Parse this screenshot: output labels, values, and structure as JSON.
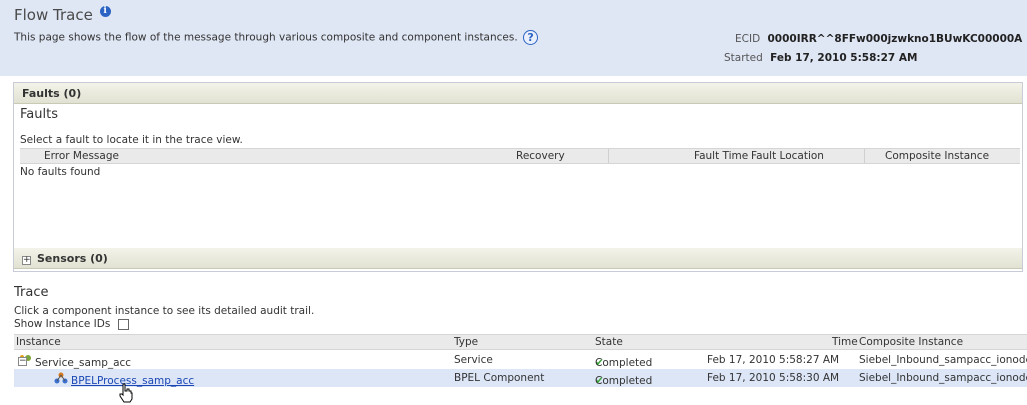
{
  "header": {
    "title": "Flow Trace",
    "description": "This page shows the flow of the message through various composite and component instances.",
    "ecid_label": "ECID",
    "ecid_value": "0000IRR^^8FFw000jzwkno1BUwKC00000A",
    "started_label": "Started",
    "started_value": "Feb 17, 2010 5:58:27 AM"
  },
  "faults": {
    "bar_label": "Faults (0)",
    "heading": "Faults",
    "hint": "Select a fault to locate it in the trace view.",
    "columns": [
      "Error Message",
      "Recovery",
      "Fault Time",
      "Fault Location",
      "Composite Instance"
    ],
    "empty_text": "No faults found"
  },
  "sensors": {
    "bar_label": "Sensors (0)"
  },
  "trace": {
    "heading": "Trace",
    "hint": "Click a component instance to see its detailed audit trail.",
    "show_ids_label": "Show Instance IDs",
    "columns": [
      "Instance",
      "Type",
      "State",
      "Time",
      "Composite Instance"
    ],
    "rows": [
      {
        "instance": "Service_samp_acc",
        "type": "Service",
        "state": "Completed",
        "time": "Feb 17, 2010 5:58:27 AM",
        "composite": "Siebel_Inbound_sampacc_ionode"
      },
      {
        "instance": "BPELProcess_samp_acc",
        "type": "BPEL Component",
        "state": "Completed",
        "time": "Feb 17, 2010 5:58:30 AM",
        "composite": "Siebel_Inbound_sampacc_ionode"
      }
    ]
  },
  "icons": {
    "info": "info-icon",
    "help": "help-icon",
    "expand": "expand-icon",
    "collapse": "collapse-icon",
    "service": "service-icon",
    "bpel": "bpel-component-icon",
    "check": "check-icon",
    "cursor": "hand-cursor-icon"
  },
  "colors": {
    "header_bg": "#dfe6f4",
    "link": "#1b47b5",
    "selected_row": "#dce6f7",
    "check": "#3aa33a"
  }
}
